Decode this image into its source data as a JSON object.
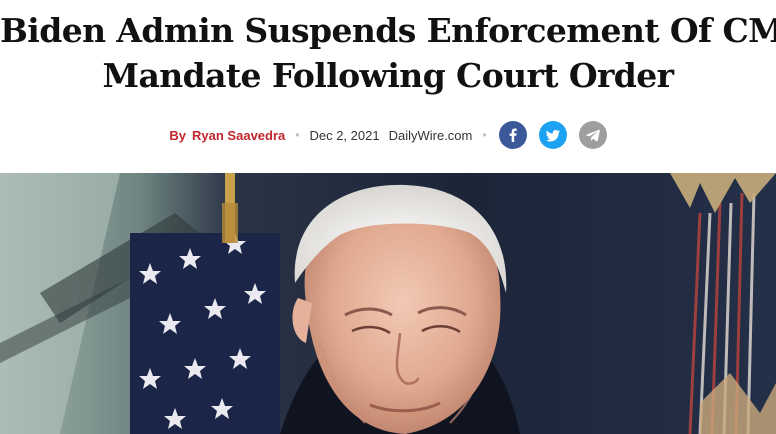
{
  "article": {
    "headline_line1": "Biden Admin Suspends Enforcement Of CMS",
    "headline_line2": "Mandate Following Court Order",
    "byline_prefix": "By",
    "author": "Ryan Saavedra",
    "separator": "•",
    "date": "Dec 2, 2021",
    "source": "DailyWire.com"
  },
  "social": [
    {
      "name": "facebook",
      "icon": "facebook-icon",
      "color": "#3b5998"
    },
    {
      "name": "twitter",
      "icon": "twitter-icon",
      "color": "#1da1f2"
    },
    {
      "name": "telegram",
      "icon": "telegram-icon",
      "color": "#9e9e9e"
    }
  ],
  "colors": {
    "author_accent": "#c0272d",
    "headline": "#111111"
  }
}
